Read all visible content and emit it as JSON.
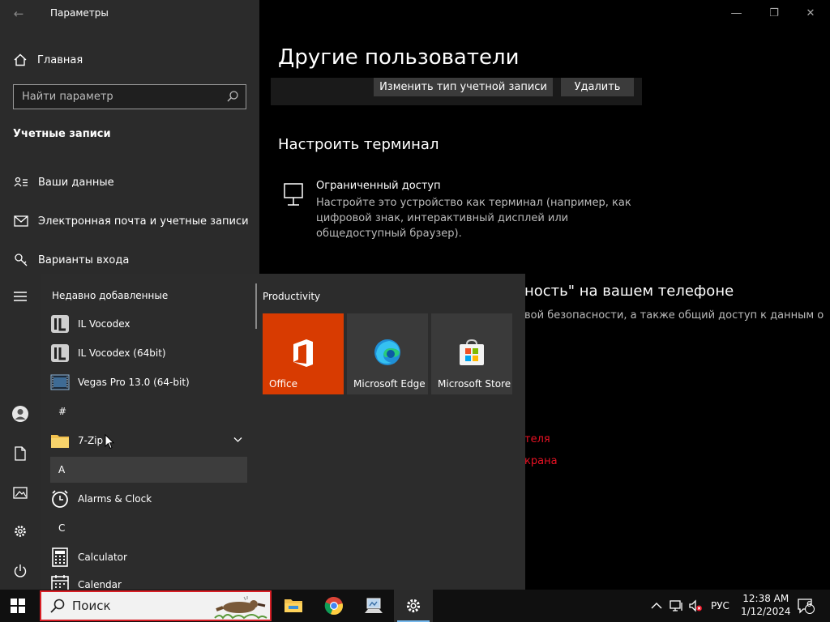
{
  "window": {
    "title": "Параметры",
    "minimize": "—",
    "restore": "❐",
    "close": "✕",
    "back": "←"
  },
  "sidebar": {
    "home_label": "Главная",
    "search_placeholder": "Найти параметр",
    "section_title": "Учетные записи",
    "items": [
      {
        "label": "Ваши данные",
        "icon": "person-card-icon"
      },
      {
        "label": "Электронная почта и учетные записи",
        "icon": "mail-icon"
      },
      {
        "label": "Варианты входа",
        "icon": "key-icon"
      }
    ]
  },
  "content": {
    "page_title": "Другие пользователи",
    "change_account_type": "Изменить тип учетной записи",
    "delete": "Удалить",
    "kiosk_heading": "Настроить терминал",
    "kiosk_title": "Ограниченный доступ",
    "kiosk_desc": "Настройте это устройство как терминал (например, как цифровой знак, интерактивный дисплей или общедоступный браузер).",
    "phone_title_fragment": "ность\" на вашем телефоне",
    "phone_desc_fragment": "вой безопасности, а также общий доступ к данным о",
    "link1_fragment": "теля",
    "link2_fragment": "крана"
  },
  "start_menu": {
    "recent_header": "Недавно добавленные",
    "recent_apps": [
      {
        "label": "IL Vocodex",
        "icon": "il-vocodex-icon"
      },
      {
        "label": "IL Vocodex (64bit)",
        "icon": "il-vocodex-icon"
      },
      {
        "label": "Vegas Pro 13.0 (64-bit)",
        "icon": "vegas-pro-icon"
      }
    ],
    "hash_letter": "#",
    "zip_label": "7-Zip",
    "letter_a": "A",
    "alarms_label": "Alarms & Clock",
    "letter_c": "C",
    "calculator_label": "Calculator",
    "calendar_label": "Calendar",
    "tiles_group": "Productivity",
    "tiles": [
      {
        "label": "Office",
        "color": "#d83b01"
      },
      {
        "label": "Microsoft Edge",
        "color": "#3a3a3a"
      },
      {
        "label": "Microsoft Store",
        "color": "#3a3a3a"
      }
    ]
  },
  "taskbar": {
    "search_label": "Поиск",
    "language": "РУС",
    "time": "12:38 AM",
    "date": "1/12/2024",
    "notification_count": "6"
  },
  "colors": {
    "accent": "#76b9ed",
    "search_border": "#d81f26",
    "office_tile": "#d83b01",
    "link_red": "#e81123"
  }
}
